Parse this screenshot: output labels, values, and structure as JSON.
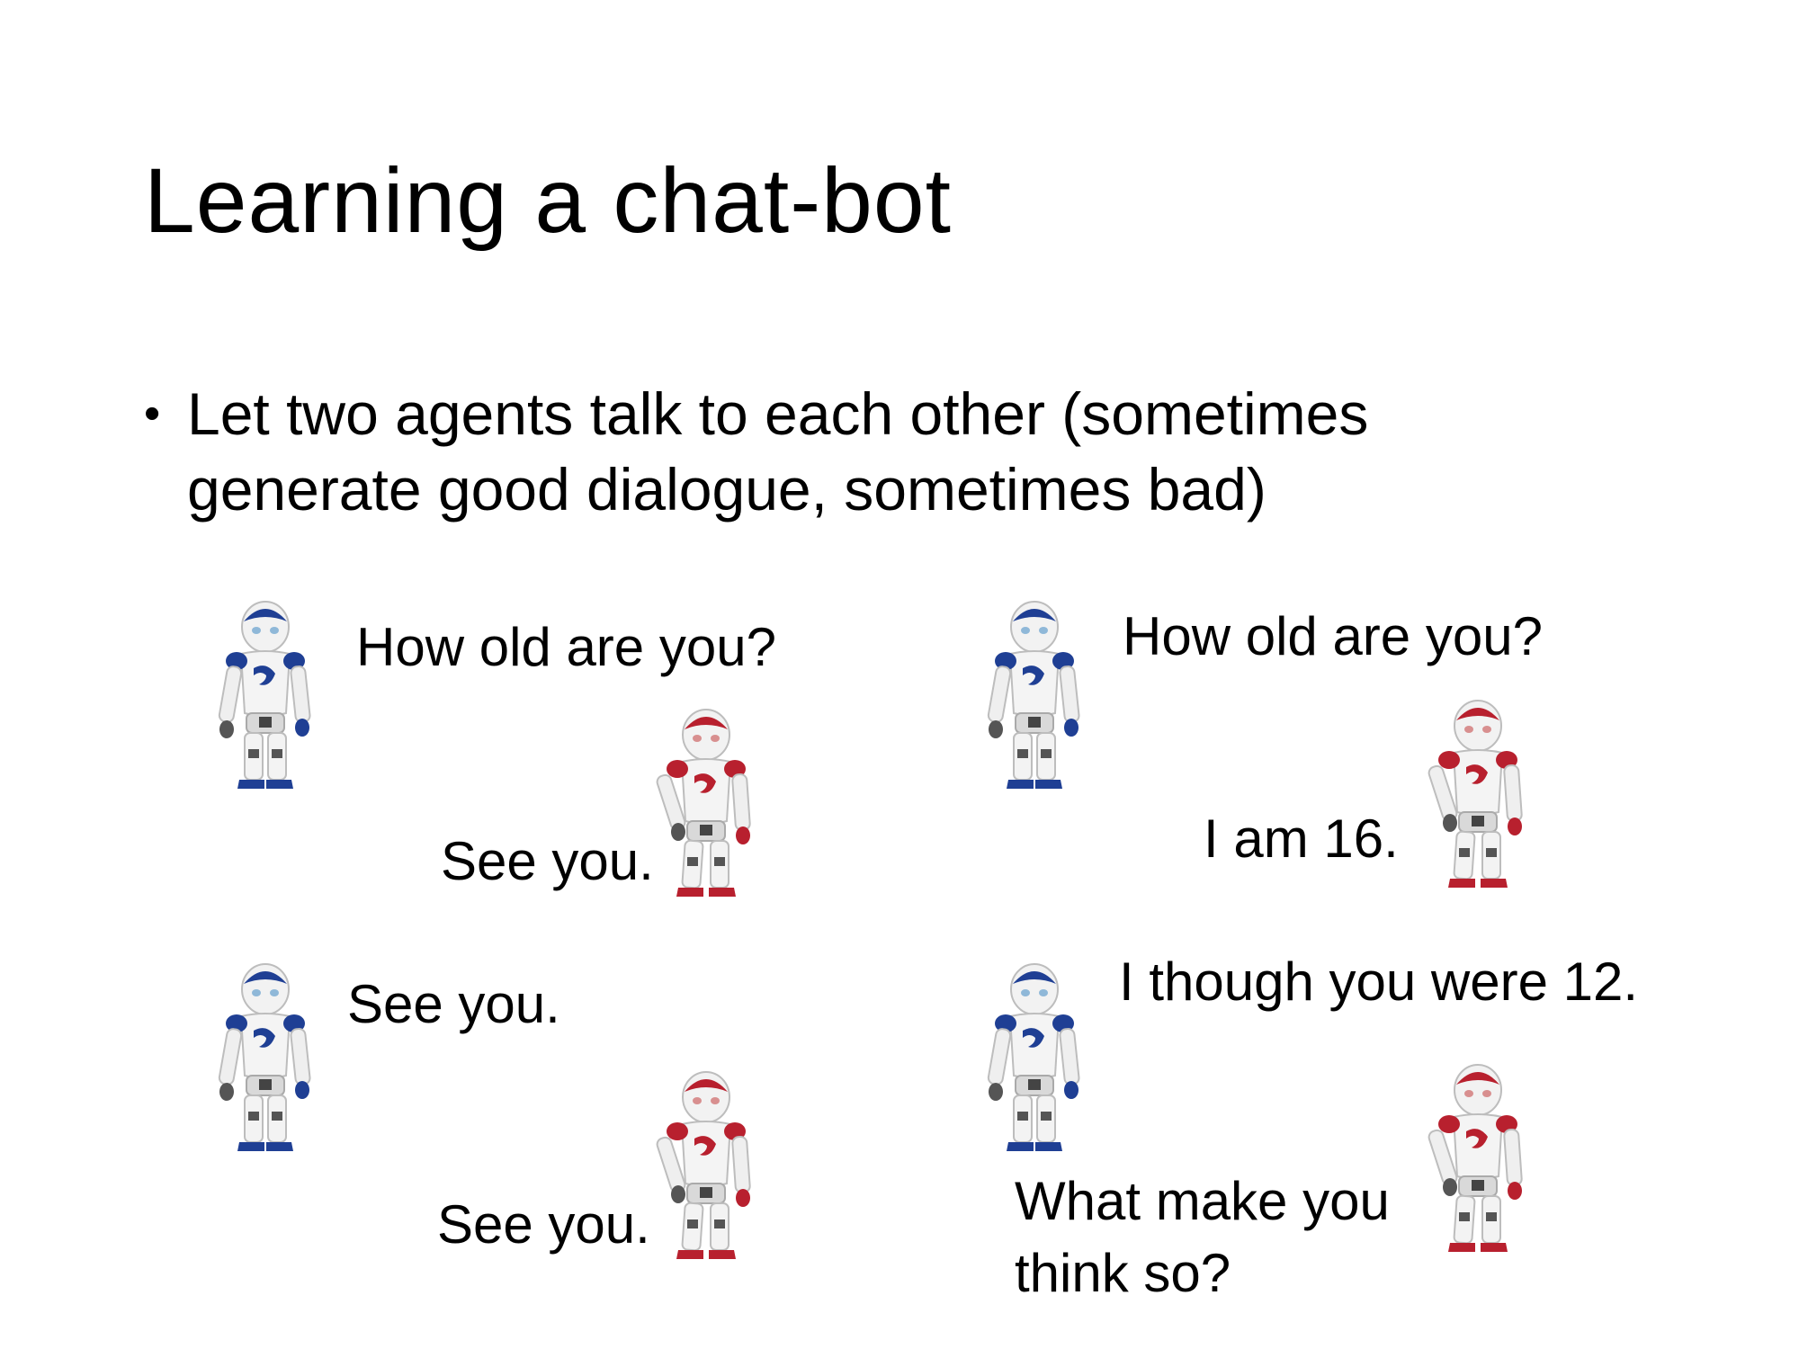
{
  "slide": {
    "title": "Learning a chat-bot",
    "bullet": {
      "symbol": "•",
      "line1": "Let two agents talk to each other (sometimes",
      "line2": "generate good dialogue, sometimes bad)"
    }
  },
  "dialogues": {
    "bad": {
      "turn1": "How old are you?",
      "turn2": "See you.",
      "turn3": "See you.",
      "turn4": "See you."
    },
    "good": {
      "turn1": "How old are you?",
      "turn2": "I am 16.",
      "turn3": "I though you were 12.",
      "turn4_line1": "What make you",
      "turn4_line2": "think so?"
    }
  },
  "agents": {
    "blue": {
      "icon": "blue-robot-icon",
      "color": "#1f3f94"
    },
    "red": {
      "icon": "red-robot-icon",
      "color": "#b8202e"
    }
  }
}
